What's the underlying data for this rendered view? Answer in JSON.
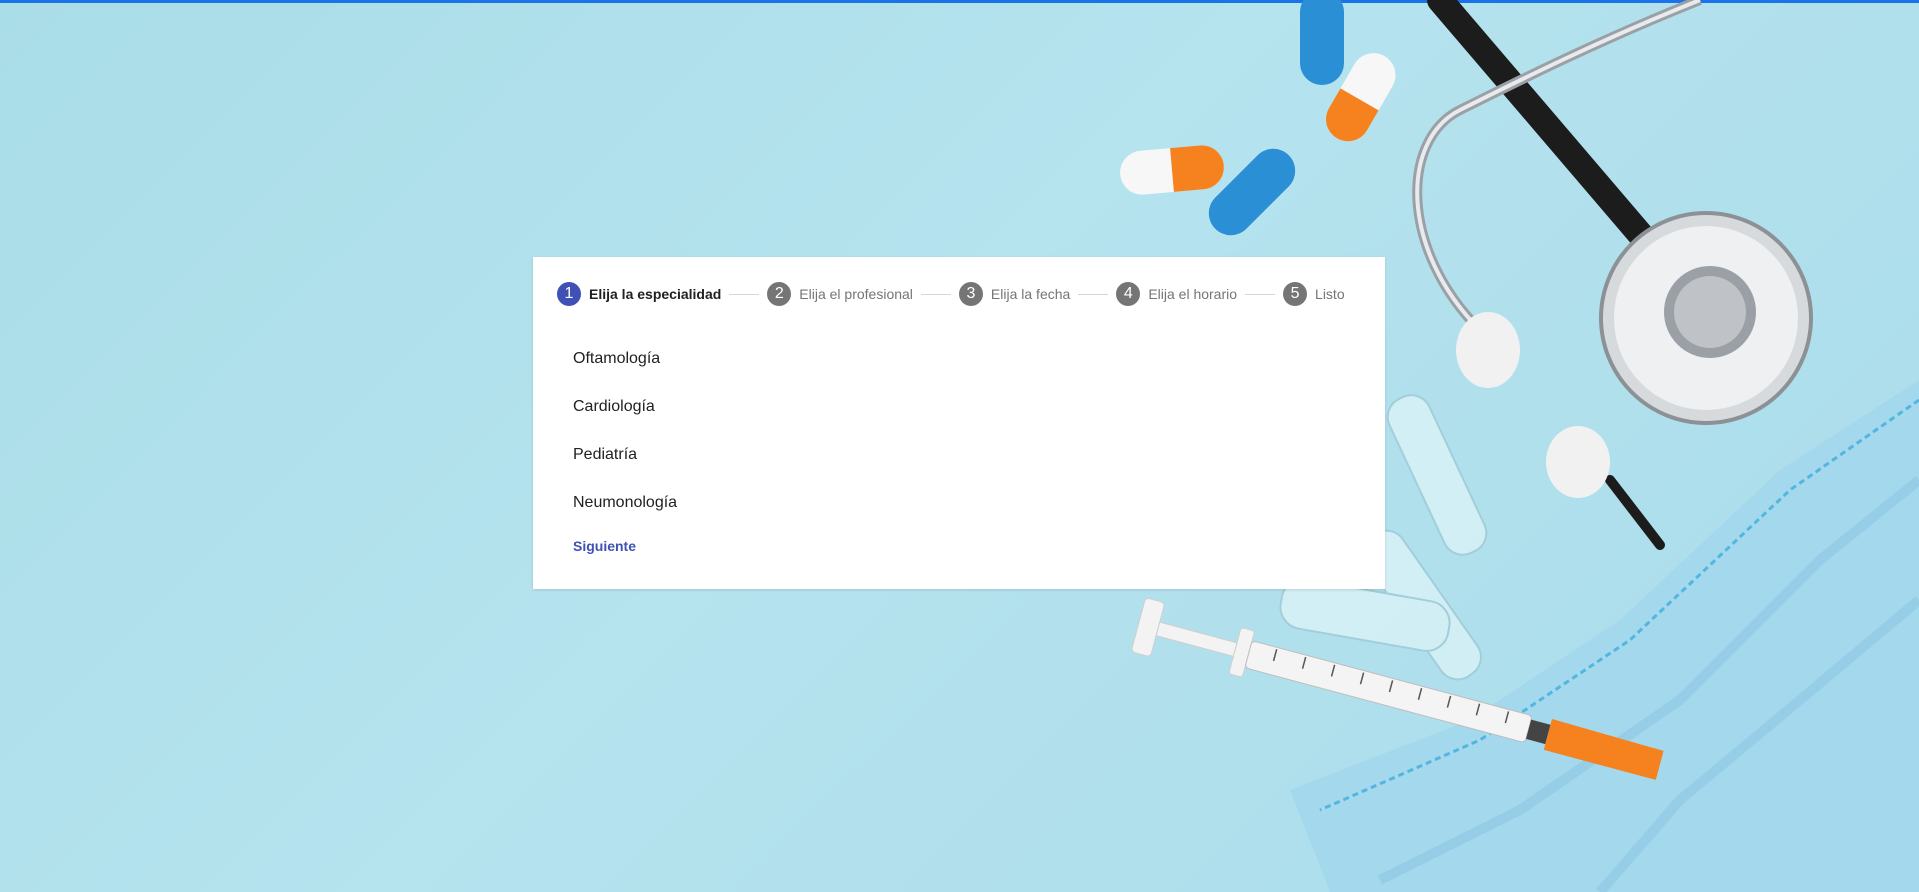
{
  "stepper": {
    "steps": [
      {
        "number": "1",
        "label": "Elija la especialidad"
      },
      {
        "number": "2",
        "label": "Elija el profesional"
      },
      {
        "number": "3",
        "label": "Elija la fecha"
      },
      {
        "number": "4",
        "label": "Elija el horario"
      },
      {
        "number": "5",
        "label": "Listo"
      }
    ],
    "active_step": 1
  },
  "specialties": [
    "Oftamología",
    "Cardiología",
    "Pediatría",
    "Neumonología"
  ],
  "actions": {
    "next_label": "Siguiente"
  },
  "colors": {
    "accent": "#3f51b5",
    "inactive_step": "#757575",
    "top_bar": "#1a73e8",
    "background": "#b0e0ea"
  }
}
